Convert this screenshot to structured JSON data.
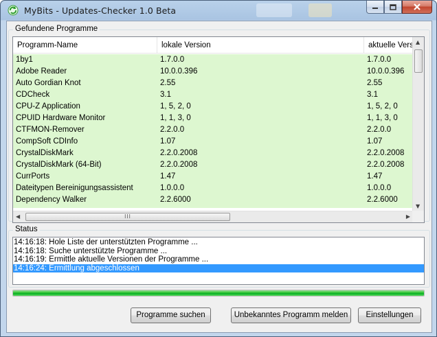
{
  "window": {
    "title": "MyBits - Updates-Checker 1.0 Beta"
  },
  "programs_group": {
    "label": "Gefundene Programme",
    "columns": [
      "Programm-Name",
      "lokale Version",
      "aktuelle Versi"
    ],
    "rows": [
      {
        "name": "1by1",
        "local": "1.7.0.0",
        "current": "1.7.0.0"
      },
      {
        "name": "Adobe Reader",
        "local": "10.0.0.396",
        "current": "10.0.0.396"
      },
      {
        "name": "Auto Gordian Knot",
        "local": "2.55",
        "current": "2.55"
      },
      {
        "name": "CDCheck",
        "local": "3.1",
        "current": "3.1"
      },
      {
        "name": "CPU-Z Application",
        "local": "1, 5, 2, 0",
        "current": "1, 5, 2, 0"
      },
      {
        "name": "CPUID Hardware Monitor",
        "local": "1, 1, 3, 0",
        "current": "1, 1, 3, 0"
      },
      {
        "name": "CTFMON-Remover",
        "local": "2.2.0.0",
        "current": "2.2.0.0"
      },
      {
        "name": "CompSoft CDInfo",
        "local": "1.07",
        "current": "1.07"
      },
      {
        "name": "CrystalDiskMark",
        "local": "2.2.0.2008",
        "current": "2.2.0.2008"
      },
      {
        "name": "CrystalDiskMark (64-Bit)",
        "local": "2.2.0.2008",
        "current": "2.2.0.2008"
      },
      {
        "name": "CurrPorts",
        "local": "1.47",
        "current": "1.47"
      },
      {
        "name": "Dateitypen Bereinigungsassistent",
        "local": "1.0.0.0",
        "current": "1.0.0.0"
      },
      {
        "name": "Dependency Walker",
        "local": "2.2.6000",
        "current": "2.2.6000"
      }
    ],
    "hscroll_grip": "III"
  },
  "status_group": {
    "label": "Status",
    "lines": [
      "14:16:18: Hole Liste der unterstützten Programme ...",
      "14:16:18: Suche unterstützte Programme ...",
      "14:16:19: Ermittle aktuelle Versionen der Programme ...",
      "14:16:24: Ermittlung abgeschlossen"
    ],
    "selected_index": 3
  },
  "progress": {
    "fraction": 1.0,
    "color": "#06b025"
  },
  "buttons": {
    "search": "Programme suchen",
    "report": "Unbekanntes Programm melden",
    "settings": "Einstellungen"
  },
  "colors": {
    "row_background": "#ddf7d0",
    "selection": "#3399ff"
  }
}
